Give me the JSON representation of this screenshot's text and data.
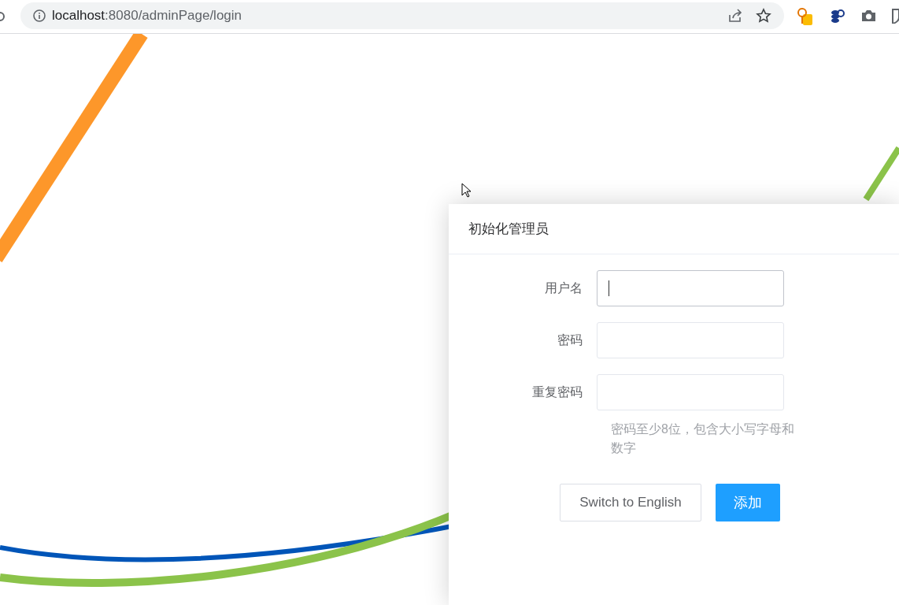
{
  "browser": {
    "url_host": "localhost",
    "url_path": ":8080/adminPage/login"
  },
  "dialog": {
    "title": "初始化管理员",
    "fields": [
      {
        "label": "用户名",
        "focused": true
      },
      {
        "label": "密码",
        "focused": false
      },
      {
        "label": "重复密码",
        "focused": false
      }
    ],
    "hint": "密码至少8位，包含大小写字母和数字",
    "buttons": [
      {
        "label": "Switch to English",
        "kind": "default"
      },
      {
        "label": "添加",
        "kind": "primary"
      }
    ]
  }
}
